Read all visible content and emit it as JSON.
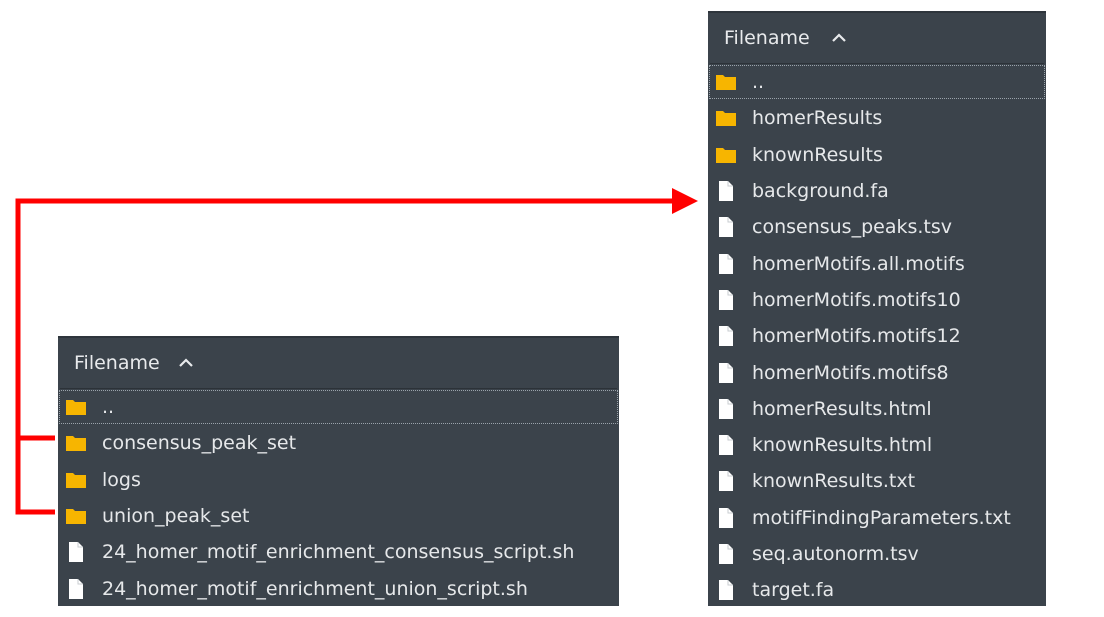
{
  "left_panel": {
    "header": {
      "label": "Filename",
      "sort_icon": "chevron-up-icon"
    },
    "items": [
      {
        "name": "..",
        "type": "folder"
      },
      {
        "name": "consensus_peak_set",
        "type": "folder"
      },
      {
        "name": "logs",
        "type": "folder"
      },
      {
        "name": "union_peak_set",
        "type": "folder"
      },
      {
        "name": "24_homer_motif_enrichment_consensus_script.sh",
        "type": "file"
      },
      {
        "name": "24_homer_motif_enrichment_union_script.sh",
        "type": "file"
      }
    ]
  },
  "right_panel": {
    "header": {
      "label": "Filename",
      "sort_icon": "chevron-up-icon"
    },
    "items": [
      {
        "name": "..",
        "type": "folder"
      },
      {
        "name": "homerResults",
        "type": "folder"
      },
      {
        "name": "knownResults",
        "type": "folder"
      },
      {
        "name": "background.fa",
        "type": "file"
      },
      {
        "name": "consensus_peaks.tsv",
        "type": "file"
      },
      {
        "name": "homerMotifs.all.motifs",
        "type": "file"
      },
      {
        "name": "homerMotifs.motifs10",
        "type": "file"
      },
      {
        "name": "homerMotifs.motifs12",
        "type": "file"
      },
      {
        "name": "homerMotifs.motifs8",
        "type": "file"
      },
      {
        "name": "homerResults.html",
        "type": "file"
      },
      {
        "name": "knownResults.html",
        "type": "file"
      },
      {
        "name": "knownResults.txt",
        "type": "file"
      },
      {
        "name": "motifFindingParameters.txt",
        "type": "file"
      },
      {
        "name": "seq.autonorm.tsv",
        "type": "file"
      },
      {
        "name": "target.fa",
        "type": "file"
      }
    ]
  },
  "colors": {
    "panel_bg": "#3b434b",
    "text": "#e6e8ea",
    "folder": "#f7b500",
    "file": "#ffffff",
    "arrow": "#ff0000"
  }
}
